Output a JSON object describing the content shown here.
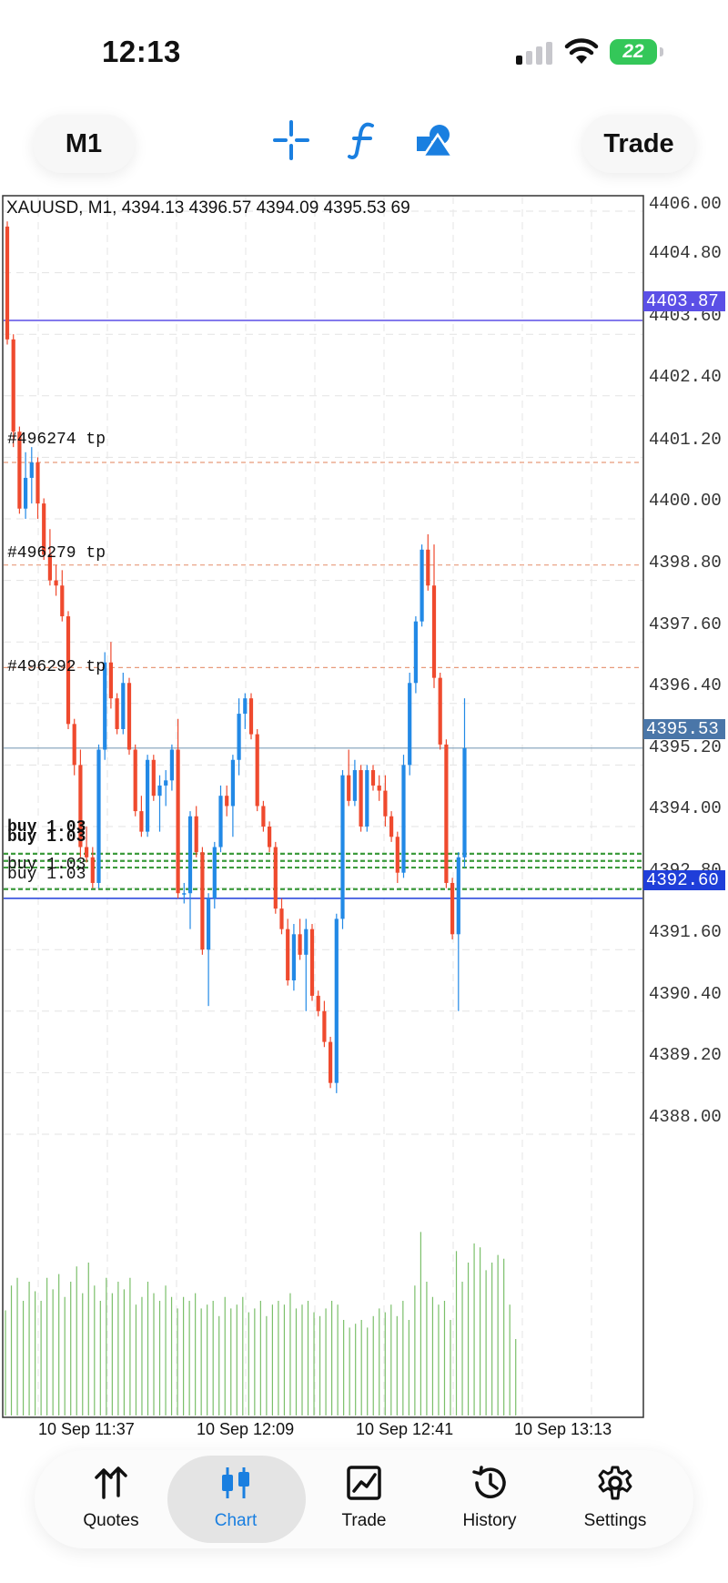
{
  "status_bar": {
    "time": "12:13",
    "battery": "22"
  },
  "toolbar": {
    "timeframe": "M1",
    "trade_label": "Trade"
  },
  "chart": {
    "header": "XAUUSD, M1, 4394.13 4396.57 4394.09 4395.53 69",
    "price_labels": [
      "4406.00",
      "4404.80",
      "4403.60",
      "4402.40",
      "4401.20",
      "4400.00",
      "4398.80",
      "4397.60",
      "4396.40",
      "4395.20",
      "4394.00",
      "4392.80",
      "4391.60",
      "4390.40",
      "4389.20",
      "4388.00"
    ],
    "price_tags": {
      "upper": "4403.87",
      "current": "4395.53",
      "lower": "4392.60"
    },
    "order_labels": [
      "#496274 tp",
      "#496279 tp",
      "#496292 tp",
      "buy 1.03",
      "buy 1.03",
      "buy 1.03",
      "buy 1.03"
    ],
    "time_labels": [
      "10 Sep 11:37",
      "10 Sep 12:09",
      "10 Sep 12:41",
      "10 Sep 13:13"
    ],
    "colors": {
      "bull": "#2289e6",
      "bear": "#ef4a2e",
      "volume": "#7bbf6a",
      "buy_line": "#1b8a1b",
      "tp_line": "#e89a7a",
      "tag_purple": "#5b4fe6",
      "tag_blue": "#1f3ed9",
      "tag_gray": "#4a76a8"
    }
  },
  "chart_data": {
    "type": "candlestick",
    "symbol": "XAUUSD",
    "timeframe": "M1",
    "ylim": [
      4388.0,
      4406.0
    ],
    "y_ticks": [
      4406.0,
      4404.8,
      4403.6,
      4402.4,
      4401.2,
      4400.0,
      4398.8,
      4397.6,
      4396.4,
      4395.2,
      4394.0,
      4392.8,
      4391.6,
      4390.4,
      4389.2,
      4388.0
    ],
    "x_ticks": [
      "10 Sep 11:37",
      "10 Sep 12:09",
      "10 Sep 12:41",
      "10 Sep 13:13"
    ],
    "ohlc": [
      [
        4405.7,
        4405.8,
        4403.4,
        4403.5
      ],
      [
        4403.5,
        4403.6,
        4401.4,
        4401.7
      ],
      [
        4401.7,
        4401.8,
        4400.1,
        4400.2
      ],
      [
        4400.2,
        4401.3,
        4400.0,
        4400.8
      ],
      [
        4400.8,
        4401.4,
        4400.3,
        4401.1
      ],
      [
        4401.1,
        4401.2,
        4400.0,
        4400.3
      ],
      [
        4400.3,
        4400.4,
        4399.2,
        4399.3
      ],
      [
        4399.3,
        4399.8,
        4398.7,
        4398.8
      ],
      [
        4398.8,
        4399.1,
        4398.5,
        4398.7
      ],
      [
        4398.7,
        4399.0,
        4398.0,
        4398.1
      ],
      [
        4398.1,
        4398.2,
        4395.9,
        4396.0
      ],
      [
        4396.0,
        4396.1,
        4395.0,
        4395.2
      ],
      [
        4395.2,
        4395.5,
        4393.4,
        4393.6
      ],
      [
        4393.6,
        4394.0,
        4393.3,
        4393.4
      ],
      [
        4393.4,
        4393.6,
        4392.8,
        4392.9
      ],
      [
        4392.9,
        4395.6,
        4392.8,
        4395.5
      ],
      [
        4395.5,
        4397.4,
        4395.3,
        4397.2
      ],
      [
        4397.2,
        4397.6,
        4396.3,
        4396.5
      ],
      [
        4396.5,
        4396.6,
        4395.8,
        4395.9
      ],
      [
        4395.9,
        4397.0,
        4395.8,
        4396.8
      ],
      [
        4396.8,
        4396.9,
        4395.4,
        4395.5
      ],
      [
        4395.5,
        4395.6,
        4394.2,
        4394.3
      ],
      [
        4394.3,
        4394.6,
        4393.8,
        4393.9
      ],
      [
        4393.9,
        4395.4,
        4393.8,
        4395.3
      ],
      [
        4395.3,
        4395.4,
        4394.5,
        4394.6
      ],
      [
        4394.6,
        4395.0,
        4393.9,
        4394.8
      ],
      [
        4394.8,
        4395.1,
        4394.4,
        4394.9
      ],
      [
        4394.9,
        4395.6,
        4394.7,
        4395.5
      ],
      [
        4395.5,
        4396.1,
        4392.6,
        4392.7
      ],
      [
        4392.7,
        4392.9,
        4392.5,
        4392.7
      ],
      [
        4392.7,
        4394.3,
        4392.0,
        4394.2
      ],
      [
        4394.2,
        4394.4,
        4393.4,
        4393.5
      ],
      [
        4393.5,
        4393.6,
        4391.5,
        4391.6
      ],
      [
        4391.6,
        4392.7,
        4390.5,
        4392.6
      ],
      [
        4392.6,
        4393.7,
        4392.4,
        4393.6
      ],
      [
        4393.6,
        4394.8,
        4393.5,
        4394.6
      ],
      [
        4394.6,
        4394.8,
        4394.2,
        4394.4
      ],
      [
        4394.4,
        4395.4,
        4393.8,
        4395.3
      ],
      [
        4395.3,
        4396.5,
        4395.0,
        4396.2
      ],
      [
        4396.2,
        4396.6,
        4395.9,
        4396.5
      ],
      [
        4396.5,
        4396.6,
        4395.7,
        4395.8
      ],
      [
        4395.8,
        4395.9,
        4394.3,
        4394.4
      ],
      [
        4394.4,
        4394.5,
        4393.9,
        4394.0
      ],
      [
        4394.0,
        4394.1,
        4393.5,
        4393.6
      ],
      [
        4393.6,
        4393.7,
        4392.3,
        4392.4
      ],
      [
        4392.4,
        4392.6,
        4391.9,
        4392.0
      ],
      [
        4392.0,
        4392.2,
        4390.9,
        4391.0
      ],
      [
        4391.0,
        4392.1,
        4390.8,
        4391.9
      ],
      [
        4391.9,
        4392.2,
        4391.4,
        4391.5
      ],
      [
        4391.5,
        4392.2,
        4390.4,
        4392.0
      ],
      [
        4392.0,
        4392.1,
        4390.6,
        4390.7
      ],
      [
        4390.7,
        4390.8,
        4390.3,
        4390.4
      ],
      [
        4390.4,
        4390.6,
        4389.7,
        4389.8
      ],
      [
        4389.8,
        4389.9,
        4388.9,
        4389.0
      ],
      [
        4389.0,
        4392.3,
        4388.8,
        4392.2
      ],
      [
        4392.2,
        4395.1,
        4392.0,
        4395.0
      ],
      [
        4395.0,
        4395.5,
        4394.4,
        4394.5
      ],
      [
        4394.5,
        4395.3,
        4394.4,
        4395.1
      ],
      [
        4395.1,
        4395.2,
        4393.9,
        4394.0
      ],
      [
        4394.0,
        4395.2,
        4393.9,
        4395.1
      ],
      [
        4395.1,
        4395.2,
        4394.7,
        4394.8
      ],
      [
        4394.8,
        4395.0,
        4394.5,
        4394.7
      ],
      [
        4394.7,
        4395.0,
        4394.0,
        4394.2
      ],
      [
        4394.2,
        4394.3,
        4393.7,
        4393.8
      ],
      [
        4393.8,
        4393.9,
        4392.9,
        4393.1
      ],
      [
        4393.1,
        4395.4,
        4393.0,
        4395.2
      ],
      [
        4395.2,
        4397.0,
        4395.0,
        4396.8
      ],
      [
        4396.8,
        4398.1,
        4396.6,
        4398.0
      ],
      [
        4398.0,
        4399.5,
        4397.9,
        4399.4
      ],
      [
        4399.4,
        4399.7,
        4398.6,
        4398.7
      ],
      [
        4398.7,
        4399.5,
        4396.7,
        4396.9
      ],
      [
        4396.9,
        4397.0,
        4395.5,
        4395.6
      ],
      [
        4395.6,
        4395.7,
        4392.8,
        4392.9
      ],
      [
        4392.9,
        4393.0,
        4391.8,
        4391.9
      ],
      [
        4391.9,
        4393.5,
        4390.4,
        4393.4
      ],
      [
        4393.4,
        4396.5,
        4393.2,
        4395.53
      ]
    ],
    "volume_relative": [
      0.55,
      0.68,
      0.72,
      0.6,
      0.7,
      0.65,
      0.6,
      0.72,
      0.66,
      0.74,
      0.62,
      0.7,
      0.78,
      0.64,
      0.8,
      0.68,
      0.6,
      0.72,
      0.64,
      0.7,
      0.66,
      0.72,
      0.58,
      0.62,
      0.7,
      0.64,
      0.6,
      0.68,
      0.62,
      0.56,
      0.62,
      0.6,
      0.64,
      0.56,
      0.58,
      0.6,
      0.52,
      0.62,
      0.56,
      0.58,
      0.62,
      0.54,
      0.56,
      0.6,
      0.52,
      0.58,
      0.6,
      0.58,
      0.64,
      0.56,
      0.58,
      0.6,
      0.54,
      0.52,
      0.56,
      0.6,
      0.58,
      0.5,
      0.46,
      0.48,
      0.5,
      0.46,
      0.52,
      0.56,
      0.54,
      0.58,
      0.52,
      0.6,
      0.5,
      0.68,
      0.96,
      0.7,
      0.62,
      0.58,
      0.6,
      0.5,
      0.86,
      0.7,
      0.8,
      0.9,
      0.88,
      0.76,
      0.8,
      0.84,
      0.82,
      0.58,
      0.4
    ],
    "horizontal_lines": [
      {
        "type": "price-tag",
        "value": 4403.87
      },
      {
        "type": "tp",
        "label": "#496274 tp",
        "value": 4401.1
      },
      {
        "type": "tp",
        "label": "#496279 tp",
        "value": 4399.1
      },
      {
        "type": "tp",
        "label": "#496292 tp",
        "value": 4397.1
      },
      {
        "type": "current",
        "value": 4395.53
      },
      {
        "type": "buy",
        "label": "buy 1.03",
        "value": 4393.47
      },
      {
        "type": "buy",
        "label": "buy 1.03",
        "value": 4393.33
      },
      {
        "type": "buy",
        "label": "buy 1.03",
        "value": 4393.2
      },
      {
        "type": "buy",
        "label": "buy 1.03",
        "value": 4392.78
      },
      {
        "type": "price-tag",
        "value": 4392.6
      }
    ]
  },
  "nav": {
    "items": [
      {
        "label": "Quotes",
        "icon": "quotes-arrows-icon"
      },
      {
        "label": "Chart",
        "icon": "candlestick-icon"
      },
      {
        "label": "Trade",
        "icon": "trade-chart-icon"
      },
      {
        "label": "History",
        "icon": "history-icon"
      },
      {
        "label": "Settings",
        "icon": "gear-icon"
      }
    ]
  }
}
